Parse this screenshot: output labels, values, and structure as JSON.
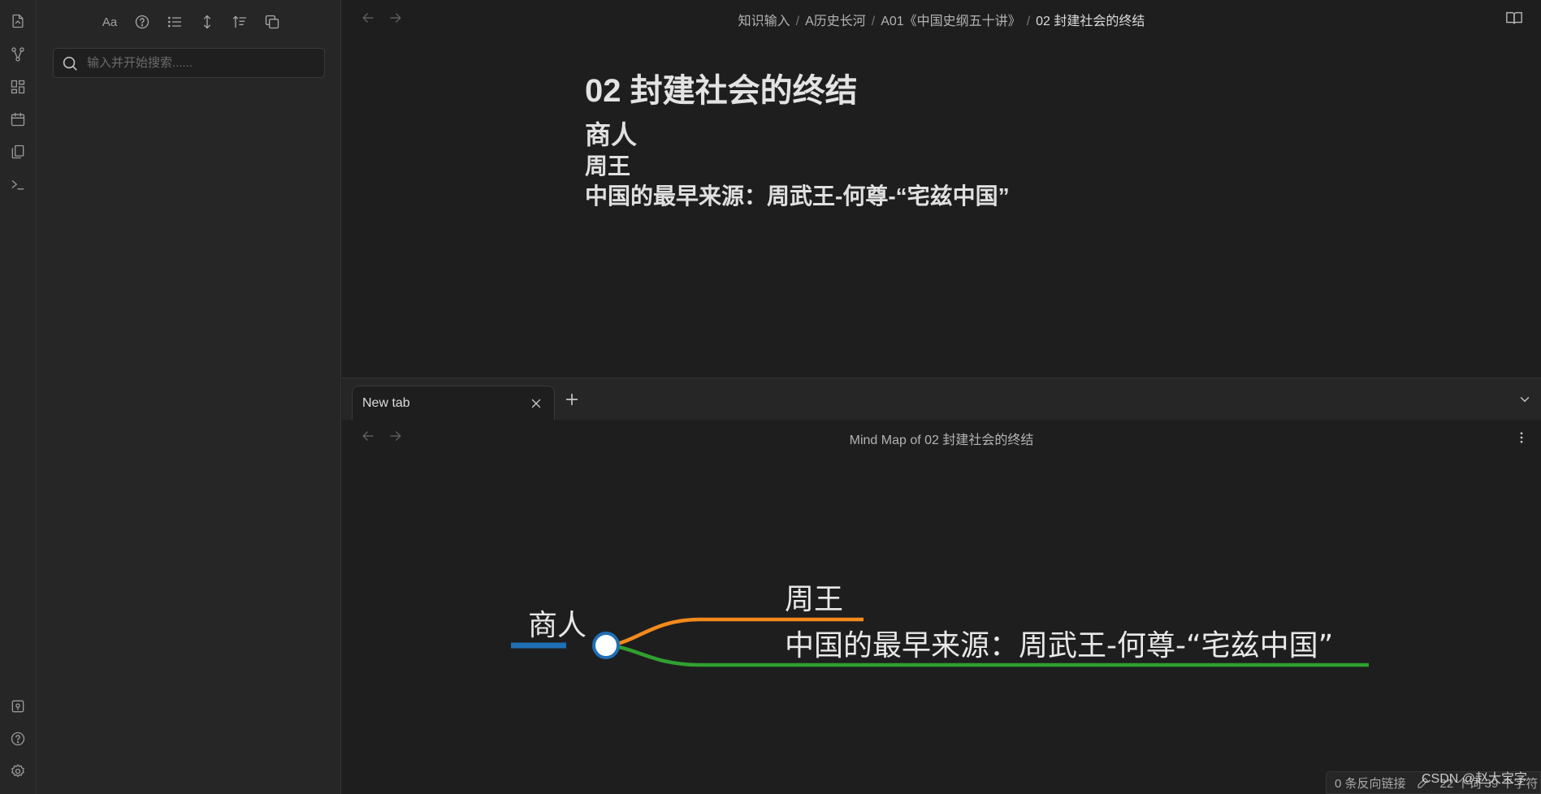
{
  "ribbon": {
    "top_icons": [
      "open-file-icon",
      "graph-view-icon",
      "canvas-icon",
      "daily-note-icon",
      "templates-icon",
      "command-palette-icon"
    ],
    "bottom_icons": [
      "vault-switch-icon",
      "help-icon",
      "settings-icon"
    ]
  },
  "sidebar": {
    "toolbar_icons": [
      "match-case-icon",
      "explain-query-icon",
      "collapse-results-icon",
      "show-more-context-icon",
      "sort-icon",
      "copy-results-icon"
    ],
    "match_case_label": "Aa",
    "search_placeholder": "输入并开始搜索......"
  },
  "top_pane": {
    "breadcrumb": [
      "知识输入",
      "A历史长河",
      "A01《中国史纲五十讲》",
      "02 封建社会的终结"
    ],
    "title": "02 封建社会的终结",
    "heading_1": "商人",
    "heading_2": "周王",
    "heading_3": "中国的最早来源：周武王-何尊-“宅兹中国”"
  },
  "tab_bar": {
    "tabs": [
      {
        "label": "New tab",
        "active": true
      }
    ]
  },
  "bottom_pane": {
    "view_title": "Mind Map of 02 封建社会的终结",
    "mindmap": {
      "root": "商人",
      "children": [
        "周王",
        "中国的最早来源：周武王-何尊-“宅兹中国”"
      ],
      "colors": {
        "root": "#1f6fb5",
        "child_1": "#f28a1c",
        "child_2": "#2fa02f"
      }
    }
  },
  "status_bar": {
    "backlinks": "0 条反向链接",
    "word_count": "22 个词 39 个字符"
  },
  "watermark": "CSDN @赵大宝字"
}
